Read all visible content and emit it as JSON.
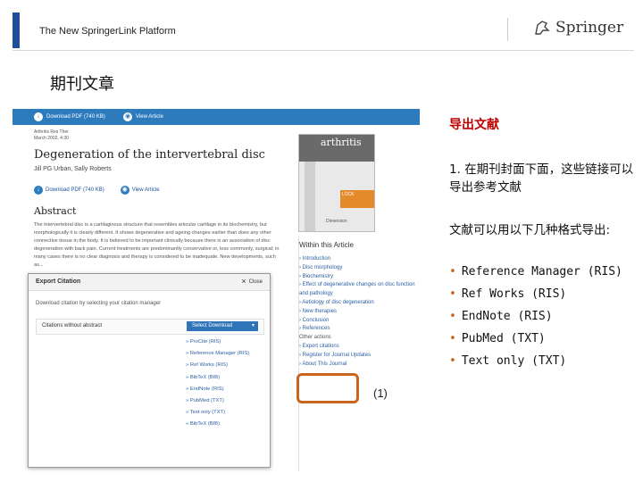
{
  "header": {
    "platform_title": "The New SpringerLink Platform",
    "logo_text": "Springer"
  },
  "page_heading": "期刊文章",
  "screenshot": {
    "top_bar": {
      "download_pdf": "Download PDF (740 KB)",
      "view_article": "View Article"
    },
    "meta_line1": "Arthritis Res Ther",
    "meta_line2": "March 2002, 4:30",
    "article_title": "Degeneration of the intervertebral disc",
    "authors": "Jill PG Urban, Sally Roberts",
    "download_pdf_2": "Download PDF (740 KB)",
    "view_article_2": "View Article",
    "abstract_heading": "Abstract",
    "abstract_text": "The intervertebral disc is a cartilaginous structure that resembles articular cartilage in its biochemistry, but morphologically it is clearly different. It shows degenerative and ageing changes earlier than does any other connective tissue in the body. It is believed to be important clinically because there is an association of disc degeneration with back pain. Current treatments are predominantly conservative or, less commonly, surgical; in many cases there is no clear diagnosis and therapy is considered to be inadequate. New developments, such as...",
    "cover": {
      "journal": "arthritis",
      "lock": "LOCK",
      "brand": "Dimension"
    },
    "within_article": {
      "heading": "Within this Article",
      "items": [
        "Introduction",
        "Disc morphology",
        "Biochemistry",
        "Effect of degenerative changes on disc function and pathology",
        "Aetiology of disc degeneration",
        "New therapies",
        "Conclusion",
        "References"
      ],
      "tools_label": "Other actions",
      "tools": [
        "Export citations",
        "Register for Journal Updates",
        "About This Journal"
      ]
    },
    "callout_number": "(1)"
  },
  "export_dialog": {
    "title": "Export Citation",
    "close_label": "Close",
    "description": "Download citation by selecting your citation manager",
    "row_label": "Citations without abstract",
    "select_label": "Select Download",
    "options": [
      "ProCite (RIS)",
      "Reference Manager (RIS)",
      "Ref Works (RIS)",
      "BibTeX (BIB)",
      "EndNote (RIS)",
      "PubMed (TXT)",
      "Text only (TXT)",
      "BibTeX (BIB)"
    ]
  },
  "annotations": {
    "title": "导出文献",
    "note": "1. 在期刊封面下面，这些链接可以导出参考文献",
    "lead": "文献可以用以下几种格式导出:",
    "formats": [
      "Reference Manager (RIS)",
      "Ref Works (RIS)",
      "EndNote (RIS)",
      "PubMed (TXT)",
      "Text only (TXT)"
    ]
  },
  "colors": {
    "brand_blue": "#2d7bbd",
    "highlight_orange": "#c8661f",
    "annotation_red": "#c00000"
  }
}
